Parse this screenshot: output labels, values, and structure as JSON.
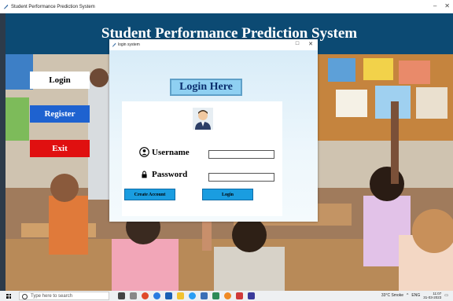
{
  "window": {
    "title": "Student Performance Prediction System"
  },
  "header": {
    "title": "Student Performance Prediction System"
  },
  "sidebar": {
    "login_label": "Login",
    "register_label": "Register",
    "exit_label": "Exit"
  },
  "dialog": {
    "title": "login system",
    "heading": "Login Here",
    "username_label": "Username",
    "password_label": "Password",
    "create_account_label": "Create Account",
    "login_label": "Login"
  },
  "taskbar": {
    "search_placeholder": "Type here to search",
    "weather": "33°C Smoke",
    "language": "ENG",
    "time": "11:07",
    "date": "31-03-2023"
  },
  "colors": {
    "header_bg": "#0c4a73",
    "register_bg": "#1e62d0",
    "exit_bg": "#e01010",
    "dialog_button": "#1a9de0"
  }
}
